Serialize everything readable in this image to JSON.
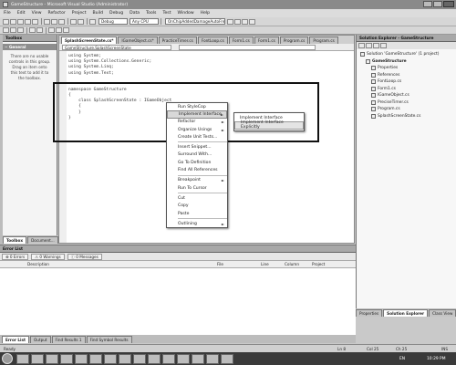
{
  "window": {
    "title": "GameStructure - Microsoft Visual Studio (Administrator)"
  },
  "menu": [
    "File",
    "Edit",
    "View",
    "Refactor",
    "Project",
    "Build",
    "Debug",
    "Data",
    "Tools",
    "Test",
    "Window",
    "Help"
  ],
  "toolbar": {
    "config": "Debug",
    "platform": "Any CPU",
    "find": "OnChipAddedDamageAutoFree"
  },
  "toolbox": {
    "title": "Toolbox",
    "section": "General",
    "empty_message": "There are no usable controls in this group. Drag an item onto this text to add it to the toolbox."
  },
  "editor": {
    "tabs": [
      "SplashScreenState.cs*",
      "IGameObject.cs*",
      "PracticeTimer.cs",
      "FontLoop.cs",
      "Form1.cs",
      "Form1.cs",
      "Program.cs",
      "Program.cs"
    ],
    "breadcrumb": "GameStructure.SplashScreenState",
    "lines": [
      "using System;",
      "using System.Collections.Generic;",
      "using System.Linq;",
      "using System.Text;",
      "",
      "namespace GameStructure",
      "{",
      "    class SplashScreenState : IGameObject",
      "    {",
      "    }",
      "}"
    ]
  },
  "context_menu": {
    "items": [
      {
        "label": "Run StyleCop",
        "submenu": false
      },
      {
        "label": "Implement Interface",
        "submenu": true,
        "highlighted": true
      },
      {
        "label": "Refactor",
        "submenu": true
      },
      {
        "label": "Organize Usings",
        "submenu": true
      },
      {
        "label": "Create Unit Tests...",
        "submenu": false
      },
      {
        "label": "Insert Snippet...",
        "submenu": false
      },
      {
        "label": "Surround With...",
        "submenu": false
      },
      {
        "label": "Go To Definition",
        "submenu": false
      },
      {
        "label": "Find All References",
        "submenu": false
      },
      {
        "label": "Breakpoint",
        "submenu": true
      },
      {
        "label": "Run To Cursor",
        "submenu": false
      },
      {
        "label": "Cut",
        "submenu": false
      },
      {
        "label": "Copy",
        "submenu": false
      },
      {
        "label": "Paste",
        "submenu": false
      },
      {
        "label": "Outlining",
        "submenu": true
      }
    ],
    "submenu": [
      "Implement Interface",
      "Implement Interface Explicitly"
    ]
  },
  "solution_explorer": {
    "title": "Solution Explorer - GameStructure",
    "items": [
      {
        "label": "Solution 'GameStructure' (1 project)",
        "level": 0
      },
      {
        "label": "GameStructure",
        "level": 1
      },
      {
        "label": "Properties",
        "level": 2
      },
      {
        "label": "References",
        "level": 2
      },
      {
        "label": "FontLoop.cs",
        "level": 2
      },
      {
        "label": "Form1.cs",
        "level": 2
      },
      {
        "label": "IGameObject.cs",
        "level": 2
      },
      {
        "label": "PreciseTimer.cs",
        "level": 2
      },
      {
        "label": "Program.cs",
        "level": 2
      },
      {
        "label": "SplashScreenState.cs",
        "level": 2
      }
    ],
    "bottom_tabs": [
      "Properties",
      "Solution Explorer",
      "Class View"
    ]
  },
  "left_tabs": [
    "Toolbox",
    "Document..."
  ],
  "error_list": {
    "title": "Error List",
    "filters": [
      "0 Errors",
      "0 Warnings",
      "0 Messages"
    ],
    "columns": [
      "Description",
      "File",
      "Line",
      "Column",
      "Project"
    ]
  },
  "bottom_tabs": [
    "Error List",
    "Output",
    "Find Results 1",
    "Find Symbol Results"
  ],
  "status": {
    "left": "Ready",
    "ln": "Ln 8",
    "col": "Col 25",
    "ch": "Ch 25",
    "mode": "INS"
  },
  "taskbar": {
    "time": "10:29 PM",
    "lang": "EN"
  }
}
